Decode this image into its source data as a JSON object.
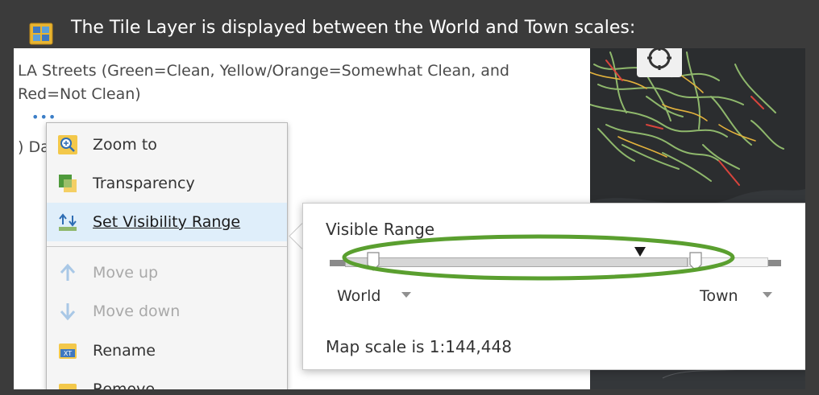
{
  "caption": "The Tile Layer is displayed between the World and Town scales:",
  "layer": {
    "title": "LA Streets (Green=Clean, Yellow/Orange=Somewhat Clean, and Red=Not Clean)",
    "options_label": "•••",
    "cut_text": ") Da"
  },
  "menu": {
    "items": [
      {
        "label": "Zoom to",
        "icon": "zoom-to-icon",
        "enabled": true
      },
      {
        "label": "Transparency",
        "icon": "transparency-icon",
        "enabled": true
      },
      {
        "label": "Set Visibility Range",
        "icon": "visibility-range-icon",
        "enabled": true,
        "active": true
      },
      {
        "label": "Move up",
        "icon": "arrow-up-icon",
        "enabled": false
      },
      {
        "label": "Move down",
        "icon": "arrow-down-icon",
        "enabled": false
      },
      {
        "label": "Rename",
        "icon": "rename-icon",
        "enabled": true
      },
      {
        "label": "Remove",
        "icon": "remove-icon",
        "enabled": true
      }
    ]
  },
  "visibility_popup": {
    "title": "Visible Range",
    "min_label": "World",
    "max_label": "Town",
    "map_scale_text": "Map scale is 1:144,448"
  },
  "colors": {
    "dark_bg": "#3b3b3b",
    "highlight": "#5a9f2f",
    "active_menu_bg": "#dfeefa",
    "map_bg": "#2b2d2f",
    "street_green": "#8fb86c",
    "street_yellow": "#e3b23c",
    "street_red": "#d9443c"
  }
}
